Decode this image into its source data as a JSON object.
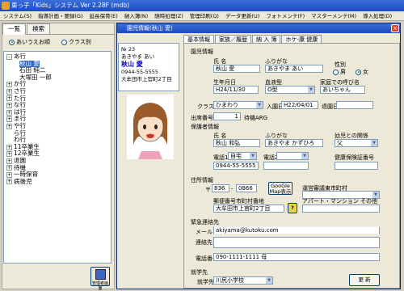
{
  "app": {
    "title": "東っ子「Kids」システム Ver 2.28F (mdb)"
  },
  "menu": [
    "システム(S)",
    "指導計画・要録(G)",
    "延長保育(E)",
    "納入簿(N)",
    "随時処理(Z)",
    "管理印刷(Q)",
    "データ更新(U)",
    "フォトメンテ(F)",
    "マスターメンテ(M)",
    "導入処理(D)"
  ],
  "left": {
    "tabs": [
      "一覧",
      "検索"
    ],
    "radios": [
      {
        "label": "あいうえお順",
        "selected": true
      },
      {
        "label": "クラス別",
        "selected": false
      }
    ],
    "tree": [
      {
        "label": "あ行",
        "expander": "-"
      },
      {
        "label": "秋山 愛",
        "child": true,
        "selected": true
      },
      {
        "label": "石田 純二",
        "child": true
      },
      {
        "label": "大塚田 一郎",
        "child": true
      },
      {
        "label": "か行",
        "expander": "+"
      },
      {
        "label": "さ行",
        "expander": "+"
      },
      {
        "label": "た行",
        "expander": "+"
      },
      {
        "label": "な行",
        "expander": "+"
      },
      {
        "label": "は行",
        "expander": "+"
      },
      {
        "label": "ま行",
        "expander": "+"
      },
      {
        "label": "や行",
        "expander": "+"
      },
      {
        "label": "ら行",
        "expander": ""
      },
      {
        "label": "わ行",
        "expander": ""
      },
      {
        "label": "11卒業生",
        "expander": "+"
      },
      {
        "label": "12卒業生",
        "expander": "+"
      },
      {
        "label": "退園",
        "expander": "+"
      },
      {
        "label": "待機",
        "expander": "+"
      },
      {
        "label": "一時保育",
        "expander": "+"
      },
      {
        "label": "病後児",
        "expander": "+"
      }
    ],
    "button_label": "管理者画面"
  },
  "child": {
    "title": "園児情報(秋山 愛)",
    "card": {
      "no": "№ 23",
      "kana": "あきやま あい",
      "name": "秋山 愛",
      "tel": "0944-55-5555",
      "addr": "大牟田市上官町2丁目"
    },
    "tabs": [
      "基本情報",
      "家族／履歴",
      "納 入 簿",
      "ホケ-康 健康"
    ],
    "basic": {
      "section_title": "園児情報",
      "name_label": "氏 名",
      "name": "秋山 愛",
      "kana_label": "ふりがな",
      "kana": "あきやま あい",
      "sex_label": "性別",
      "sex_male": "男",
      "sex_female": "女",
      "sex_selected": "female",
      "birth_label": "生年月日",
      "birth": "H24/11/30",
      "blood_label": "血液型",
      "blood": "O型",
      "nick_label": "家庭での呼び名",
      "nick": "あいちゃん",
      "class_label": "クラス",
      "class": "ひまわり",
      "enter_label": "入園日",
      "enter": "H22/04/01",
      "leave_label": "退園日",
      "leave": "",
      "order_label": "出席番号",
      "order": "1",
      "wait_label": "待機ARG",
      "guardian_title": "保護者情報",
      "g_name_label": "氏 名",
      "g_name": "秋山 和弘",
      "g_kana_label": "ふりがな",
      "g_kana": "あきやま かずひろ",
      "g_rel_label": "幼児との関係",
      "g_rel": "父",
      "tel1_label": "電話1",
      "tel1_type": "自宅",
      "tel1": "0944-55-5555",
      "tel2_label": "電話2",
      "tel2": "",
      "ins_label": "健康保険証番号",
      "ins": "",
      "addr_title": "住所情報",
      "zip_mark": "〒",
      "zip1": "836",
      "zip2": "0866",
      "map_btn": "GooGle Map表示",
      "pref_label": "郵便番号市町村番地",
      "addr": "大牟田市上官町2丁目",
      "apt_label": "アパート・マンション その他",
      "apt": "",
      "ward_label": "運営審議東市町村",
      "emg_title": "緊急連絡先",
      "mail_label": "メール",
      "mail": "akiyama@kutoku.com",
      "contact_label": "連絡先",
      "phone_label": "電話番号",
      "phone": "090-1111-1111 母",
      "school_title": "就学先",
      "school_label": "就学先",
      "school": "川尻小学校",
      "update_btn": "更 新"
    }
  }
}
